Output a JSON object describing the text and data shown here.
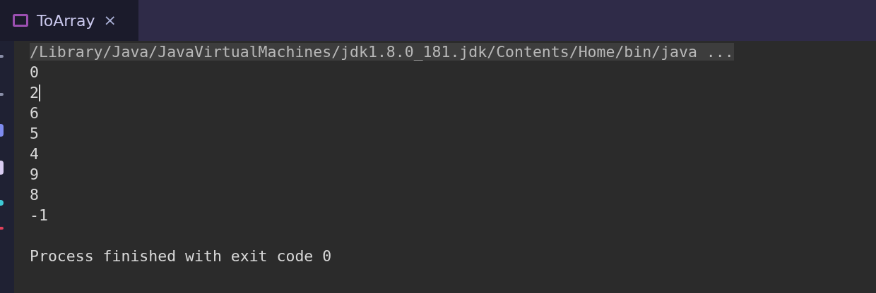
{
  "tab": {
    "title": "ToArray",
    "close": "×",
    "selected": true
  },
  "console": {
    "command": "/Library/Java/JavaVirtualMachines/jdk1.8.0_181.jdk/Contents/Home/bin/java ...",
    "lines": [
      "0",
      "2",
      "6",
      "5",
      "4",
      "9",
      "8",
      "-1"
    ],
    "exit_message": "Process finished with exit code 0"
  }
}
